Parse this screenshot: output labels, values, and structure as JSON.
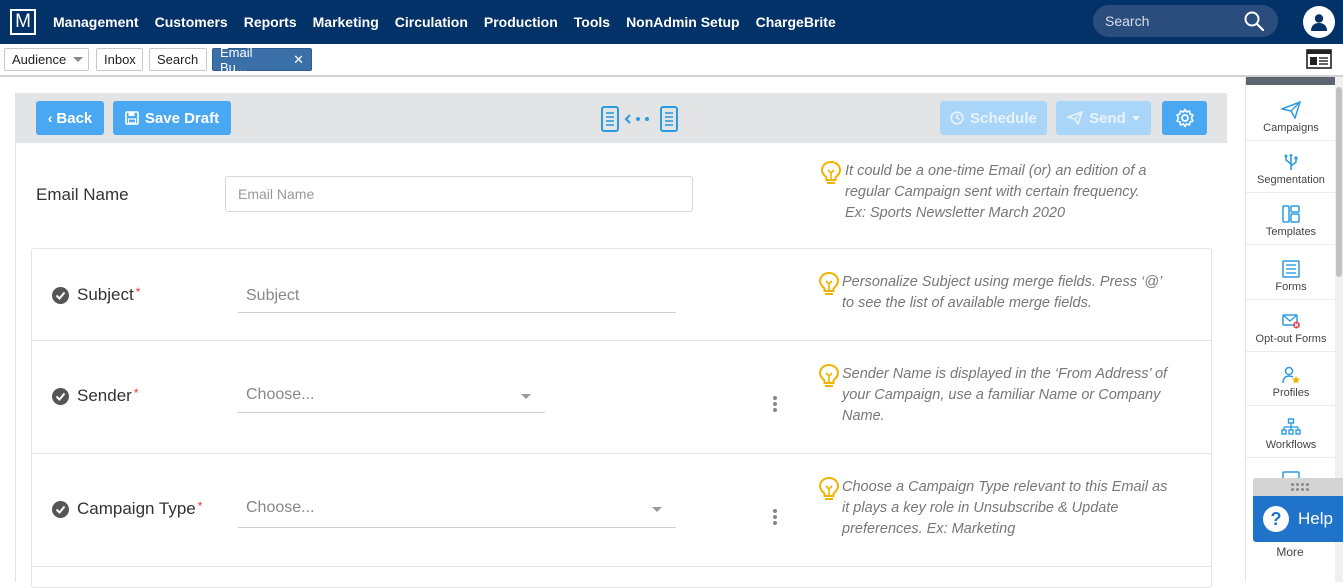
{
  "app": {
    "logo": "M"
  },
  "nav": {
    "items": [
      "Management",
      "Customers",
      "Reports",
      "Marketing",
      "Circulation",
      "Production",
      "Tools",
      "NonAdmin Setup",
      "ChargeBrite"
    ],
    "search_placeholder": "Search"
  },
  "tabs": [
    {
      "label": "Audience"
    },
    {
      "label": "Inbox"
    },
    {
      "label": "Search"
    },
    {
      "label": "Email Bu..."
    }
  ],
  "toolbar": {
    "back_label": "Back",
    "save_draft_label": "Save Draft",
    "schedule_label": "Schedule",
    "send_label": "Send"
  },
  "form": {
    "email_name": {
      "label": "Email Name",
      "placeholder": "Email Name",
      "hint": [
        "It could be a one-time Email (or) an edition of a",
        "regular Campaign sent with certain frequency.",
        "Ex: Sports Newsletter March 2020"
      ]
    },
    "subject": {
      "label": "Subject",
      "required": "*",
      "placeholder": "Subject",
      "hint": [
        "Personalize Subject using merge fields. Press ‘@’",
        "to see the list of available merge fields."
      ]
    },
    "sender": {
      "label": "Sender",
      "required": "*",
      "value": "Choose...",
      "hint": [
        "Sender Name is displayed in the ‘From Address’ of",
        "your Campaign, use a familiar Name or Company",
        "Name."
      ]
    },
    "campaign_type": {
      "label": "Campaign Type",
      "required": "*",
      "value": "Choose...",
      "hint": [
        "Choose a Campaign Type relevant to this Email as",
        "it plays a key role in Unsubscribe & Update",
        "preferences. Ex: Marketing"
      ]
    }
  },
  "side": {
    "items": [
      {
        "label": "Campaigns",
        "icon": "paper-plane-icon"
      },
      {
        "label": "Segmentation",
        "icon": "usb-branch-icon"
      },
      {
        "label": "Templates",
        "icon": "templates-icon"
      },
      {
        "label": "Forms",
        "icon": "forms-icon"
      },
      {
        "label": "Opt-out Forms",
        "icon": "optout-mail-icon"
      },
      {
        "label": "Profiles",
        "icon": "profile-star-icon"
      },
      {
        "label": "Workflows",
        "icon": "workflow-icon"
      }
    ],
    "help_label": "Help",
    "more_label": "More"
  },
  "colors": {
    "nav": "#033268",
    "accent": "#4aa8f2",
    "bulb": "#f0b400",
    "help": "#1f73c9",
    "side_icon": "#2b9be0"
  }
}
